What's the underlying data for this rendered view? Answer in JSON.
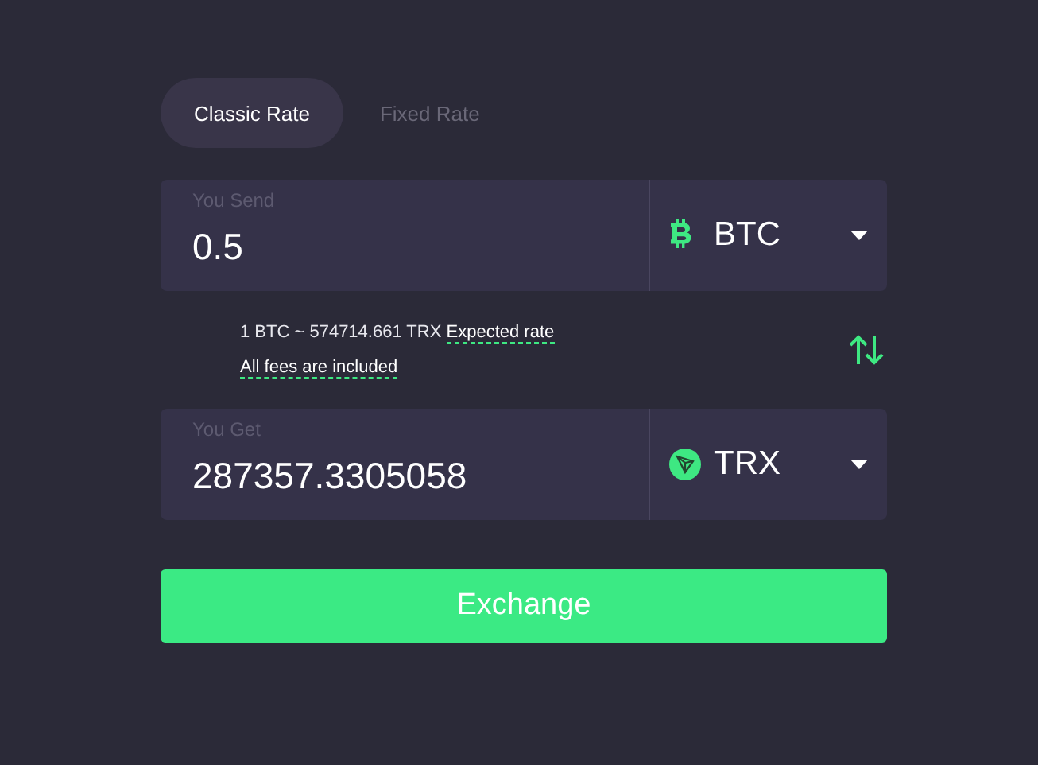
{
  "tabs": [
    {
      "label": "Classic Rate",
      "selected": true
    },
    {
      "label": "Fixed Rate",
      "selected": false
    }
  ],
  "send": {
    "label": "You Send",
    "value": "0.5",
    "currency": {
      "code": "BTC",
      "kind": "btc"
    }
  },
  "rate": {
    "text": "1 BTC ~ 574714.661 TRX",
    "link": "Expected rate"
  },
  "fees": {
    "link": "All fees are included"
  },
  "get": {
    "label": "You Get",
    "value": "287357.3305058",
    "currency": {
      "code": "TRX",
      "kind": "trx"
    }
  },
  "submit": "Exchange"
}
